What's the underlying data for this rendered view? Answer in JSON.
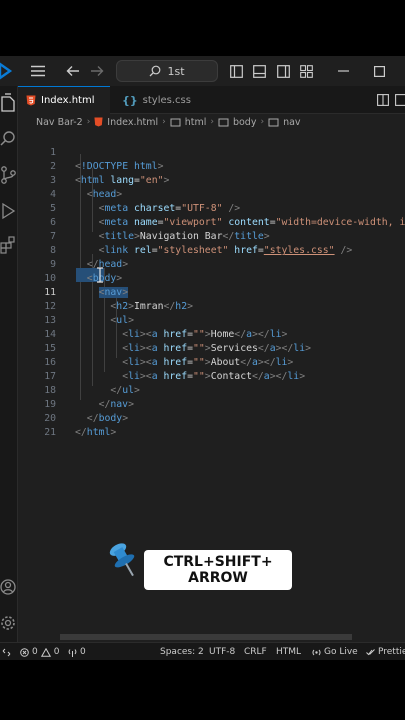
{
  "titlebar": {
    "search_text": "1st"
  },
  "tabs": [
    {
      "label": "Index.html",
      "icon": "html-file-icon",
      "active": true
    },
    {
      "label": "styles.css",
      "icon": "css-file-icon",
      "active": false
    }
  ],
  "breadcrumb": [
    "Nav Bar-2",
    "Index.html",
    "html",
    "body",
    "nav"
  ],
  "editor": {
    "current_line": 11,
    "lines": [
      {
        "n": "1"
      },
      {
        "n": "2"
      },
      {
        "n": "3"
      },
      {
        "n": "4"
      },
      {
        "n": "5"
      },
      {
        "n": "6"
      },
      {
        "n": "7"
      },
      {
        "n": "8"
      },
      {
        "n": "9"
      },
      {
        "n": "10"
      },
      {
        "n": "11"
      },
      {
        "n": "12"
      },
      {
        "n": "13"
      },
      {
        "n": "14"
      },
      {
        "n": "15"
      },
      {
        "n": "16"
      },
      {
        "n": "17"
      },
      {
        "n": "18"
      },
      {
        "n": "19"
      },
      {
        "n": "20"
      },
      {
        "n": "21"
      }
    ],
    "code": {
      "l1": "!DOCTYPE html",
      "l2_tag": "html",
      "l2_attr": "lang",
      "l2_val": "\"en\"",
      "l3_tag": "head",
      "l4_tag": "meta",
      "l4_attr": "charset",
      "l4_val": "\"UTF-8\"",
      "l5_tag": "meta",
      "l5_attr1": "name",
      "l5_val1": "\"viewport\"",
      "l5_attr2": "content",
      "l5_val2": "\"width=device-width, in",
      "l6_tag": "title",
      "l6_text": "Navigation Bar",
      "l7_tag": "link",
      "l7_attr1": "rel",
      "l7_val1": "\"stylesheet\"",
      "l7_attr2": "href",
      "l7_val2": "\"styles.css\"",
      "l8_tag": "head",
      "l9_tag": "body",
      "l10_tag": "nav",
      "l11_tag": "h2",
      "l11_text": "Imran",
      "l12_tag": "ul",
      "li_tag": "li",
      "a_tag": "a",
      "href_attr": "href",
      "href_val": "\"\"",
      "l13_text": "Home",
      "l14_text": "Services",
      "l15_text": "About",
      "l16_text": "Contact",
      "l17_tag": "ul",
      "l18_tag": "nav",
      "l19_tag": "body",
      "l20_tag": "html"
    }
  },
  "statusbar": {
    "errors": "0",
    "warnings": "0",
    "ports": "0",
    "spaces": "Spaces: 2",
    "encoding": "UTF-8",
    "eol": "CRLF",
    "language": "HTML",
    "golive": "Go Live",
    "prettier": "Prettie"
  },
  "overlay": {
    "line1": "CTRL+SHIFT+",
    "line2": "ARROW"
  },
  "colors": {
    "accent": "#0078d4",
    "tag": "#569cd6",
    "attr": "#9cdcfe",
    "string": "#ce9178",
    "selection": "#264f78"
  }
}
